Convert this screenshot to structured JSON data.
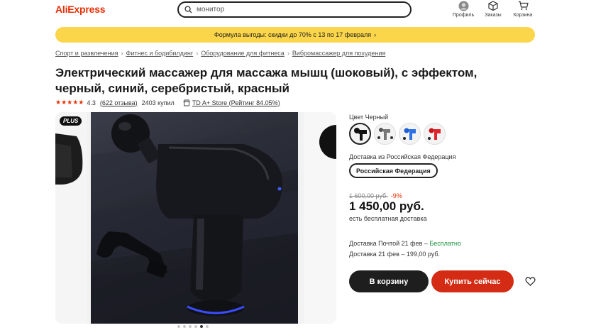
{
  "header": {
    "logo": "AliExpress",
    "search_placeholder": "монитор",
    "profile_label": "Профиль",
    "orders_label": "Заказы",
    "cart_label": "Корзина"
  },
  "promo": {
    "text": "Формула выгоды: скидки до 70% с 13 по 17 февраля"
  },
  "breadcrumbs": [
    "Спорт и развлечения",
    "Фитнес и бодибилдинг",
    "Оборудование для фитнеса",
    "Вибромассажер для похудения"
  ],
  "product": {
    "title": "Электрический массажер для массажа мышц (шоковый), с эффектом, черный, синий, серебристый, красный",
    "rating": "4.3",
    "stars": "★★★★★",
    "reviews": "(622 отзыва)",
    "sold": "2403 купил",
    "store": "TD A+ Store (Рейтинг 84.05%)",
    "plus_badge": "PLUS",
    "color_label": "Цвет Черный",
    "ship_from_label": "Доставка из Российская Федерация",
    "ship_region": "Российская Федерация",
    "old_price": "1 600,00 руб.",
    "discount": "-9%",
    "price": "1 450,00 руб.",
    "free_shipping": "есть бесплатная доставка",
    "delivery1_prefix": "Доставка Почтой 21 фев – ",
    "delivery1_free": "Бесплатно",
    "delivery2": "Доставка 21 фев – 199,00 руб.",
    "add_to_cart": "В корзину",
    "buy_now": "Купить сейчас"
  },
  "colors": {
    "accent": "#e62e04",
    "promo_bg": "#fbd54a",
    "buy_button": "#d42b14",
    "cart_button": "#1e1e1e"
  },
  "gallery": {
    "total_images": 6,
    "active_index": 4
  }
}
